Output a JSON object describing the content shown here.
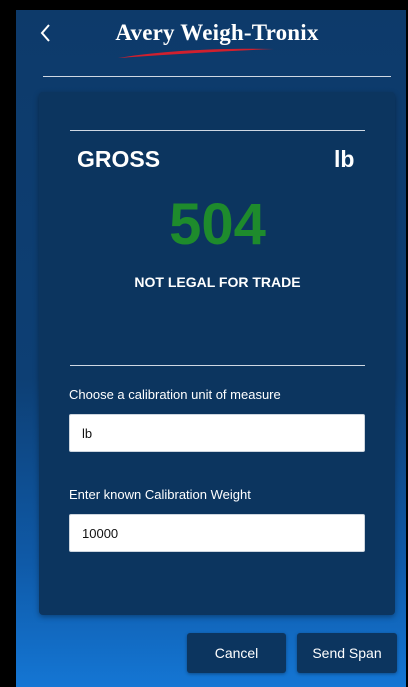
{
  "header": {
    "back_icon": "chevron-left-icon",
    "logo_text": "Avery Weigh-Tronix",
    "logo_swoosh_color": "#d0202e"
  },
  "display": {
    "mode": "GROSS",
    "unit": "lb",
    "weight": "504",
    "weight_color": "#1e8b2c",
    "legal_status": "NOT LEGAL FOR TRADE"
  },
  "form": {
    "unit_label": "Choose a calibration unit of measure",
    "unit_value": "lb",
    "weight_label": "Enter known Calibration Weight",
    "weight_value": "10000"
  },
  "actions": {
    "cancel_label": "Cancel",
    "send_label": "Send Span"
  }
}
